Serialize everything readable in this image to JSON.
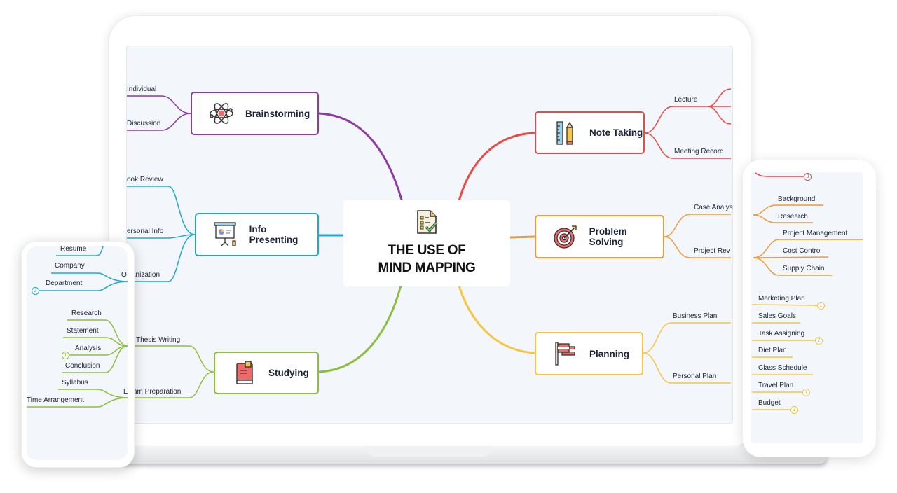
{
  "central_topic": {
    "line1": "THE USE OF",
    "line2": "MIND MAPPING",
    "icon": "checklist-icon"
  },
  "branches": {
    "brainstorming": {
      "label": "Brainstorming",
      "color": "#8e3ba3",
      "icon": "atom-icon",
      "children": [
        "Individual",
        "Discussion"
      ]
    },
    "info_presenting": {
      "label": "Info Presenting",
      "color": "#21a8d0",
      "icon": "presentation-board-icon",
      "children": [
        "Book Review",
        "Personal Info",
        "Organization"
      ]
    },
    "studying": {
      "label": "Studying",
      "color": "#8cbf3f",
      "icon": "book-icon",
      "children": [
        "Thesis Writing",
        "Exam Preparation"
      ]
    },
    "note_taking": {
      "label": "Note Taking",
      "color": "#ea4a44",
      "icon": "ruler-pencil-icon",
      "children": [
        "Lecture",
        "Meeting Record"
      ]
    },
    "problem_solving": {
      "label": "Problem Solving",
      "color": "#f29a38",
      "icon": "target-icon",
      "children": [
        "Case Analysis",
        "Project Review"
      ]
    },
    "planning": {
      "label": "Planning",
      "color": "#f6c643",
      "icon": "flag-icon",
      "children": [
        "Business Plan",
        "Personal Plan"
      ]
    }
  },
  "laptop_visible_labels": {
    "individual": "Individual",
    "discussion": "Discussion",
    "book_review": "ook Review",
    "personal_info": "ersonal Info",
    "organization": "anization",
    "thesis_writing": "Thesis Writing",
    "exam_preparation": "am Preparation",
    "lecture": "Lecture",
    "meeting_record": "Meeting Record",
    "case_analysis": "Case Analys",
    "project_review": "Project Rev",
    "business_plan": "Business Plan",
    "personal_plan": "Personal Plan"
  },
  "phone": {
    "blue_items": [
      "Resume",
      "Company",
      "Department"
    ],
    "green_items": [
      "Research",
      "Statement",
      "Analysis",
      "Conclusion",
      "Syllabus",
      "Time Arrangement"
    ],
    "organization_partial": "O",
    "exam_partial": "E",
    "badges": {
      "department": "2",
      "analysis": "1"
    }
  },
  "tablet": {
    "red_badge": "3",
    "orange_case_items": [
      "Background",
      "Research"
    ],
    "orange_review_items": [
      "Project Management",
      "Cost Control",
      "Supply Chain"
    ],
    "yellow_business_items": [
      "Marketing Plan",
      "Sales Goals",
      "Task Assigning"
    ],
    "yellow_personal_items": [
      "Diet Plan",
      "Class Schedule",
      "Travel Plan",
      "Budget"
    ],
    "badges": {
      "marketing_plan": "1",
      "task_assigning": "2",
      "travel_plan": "7",
      "budget": "3"
    }
  }
}
